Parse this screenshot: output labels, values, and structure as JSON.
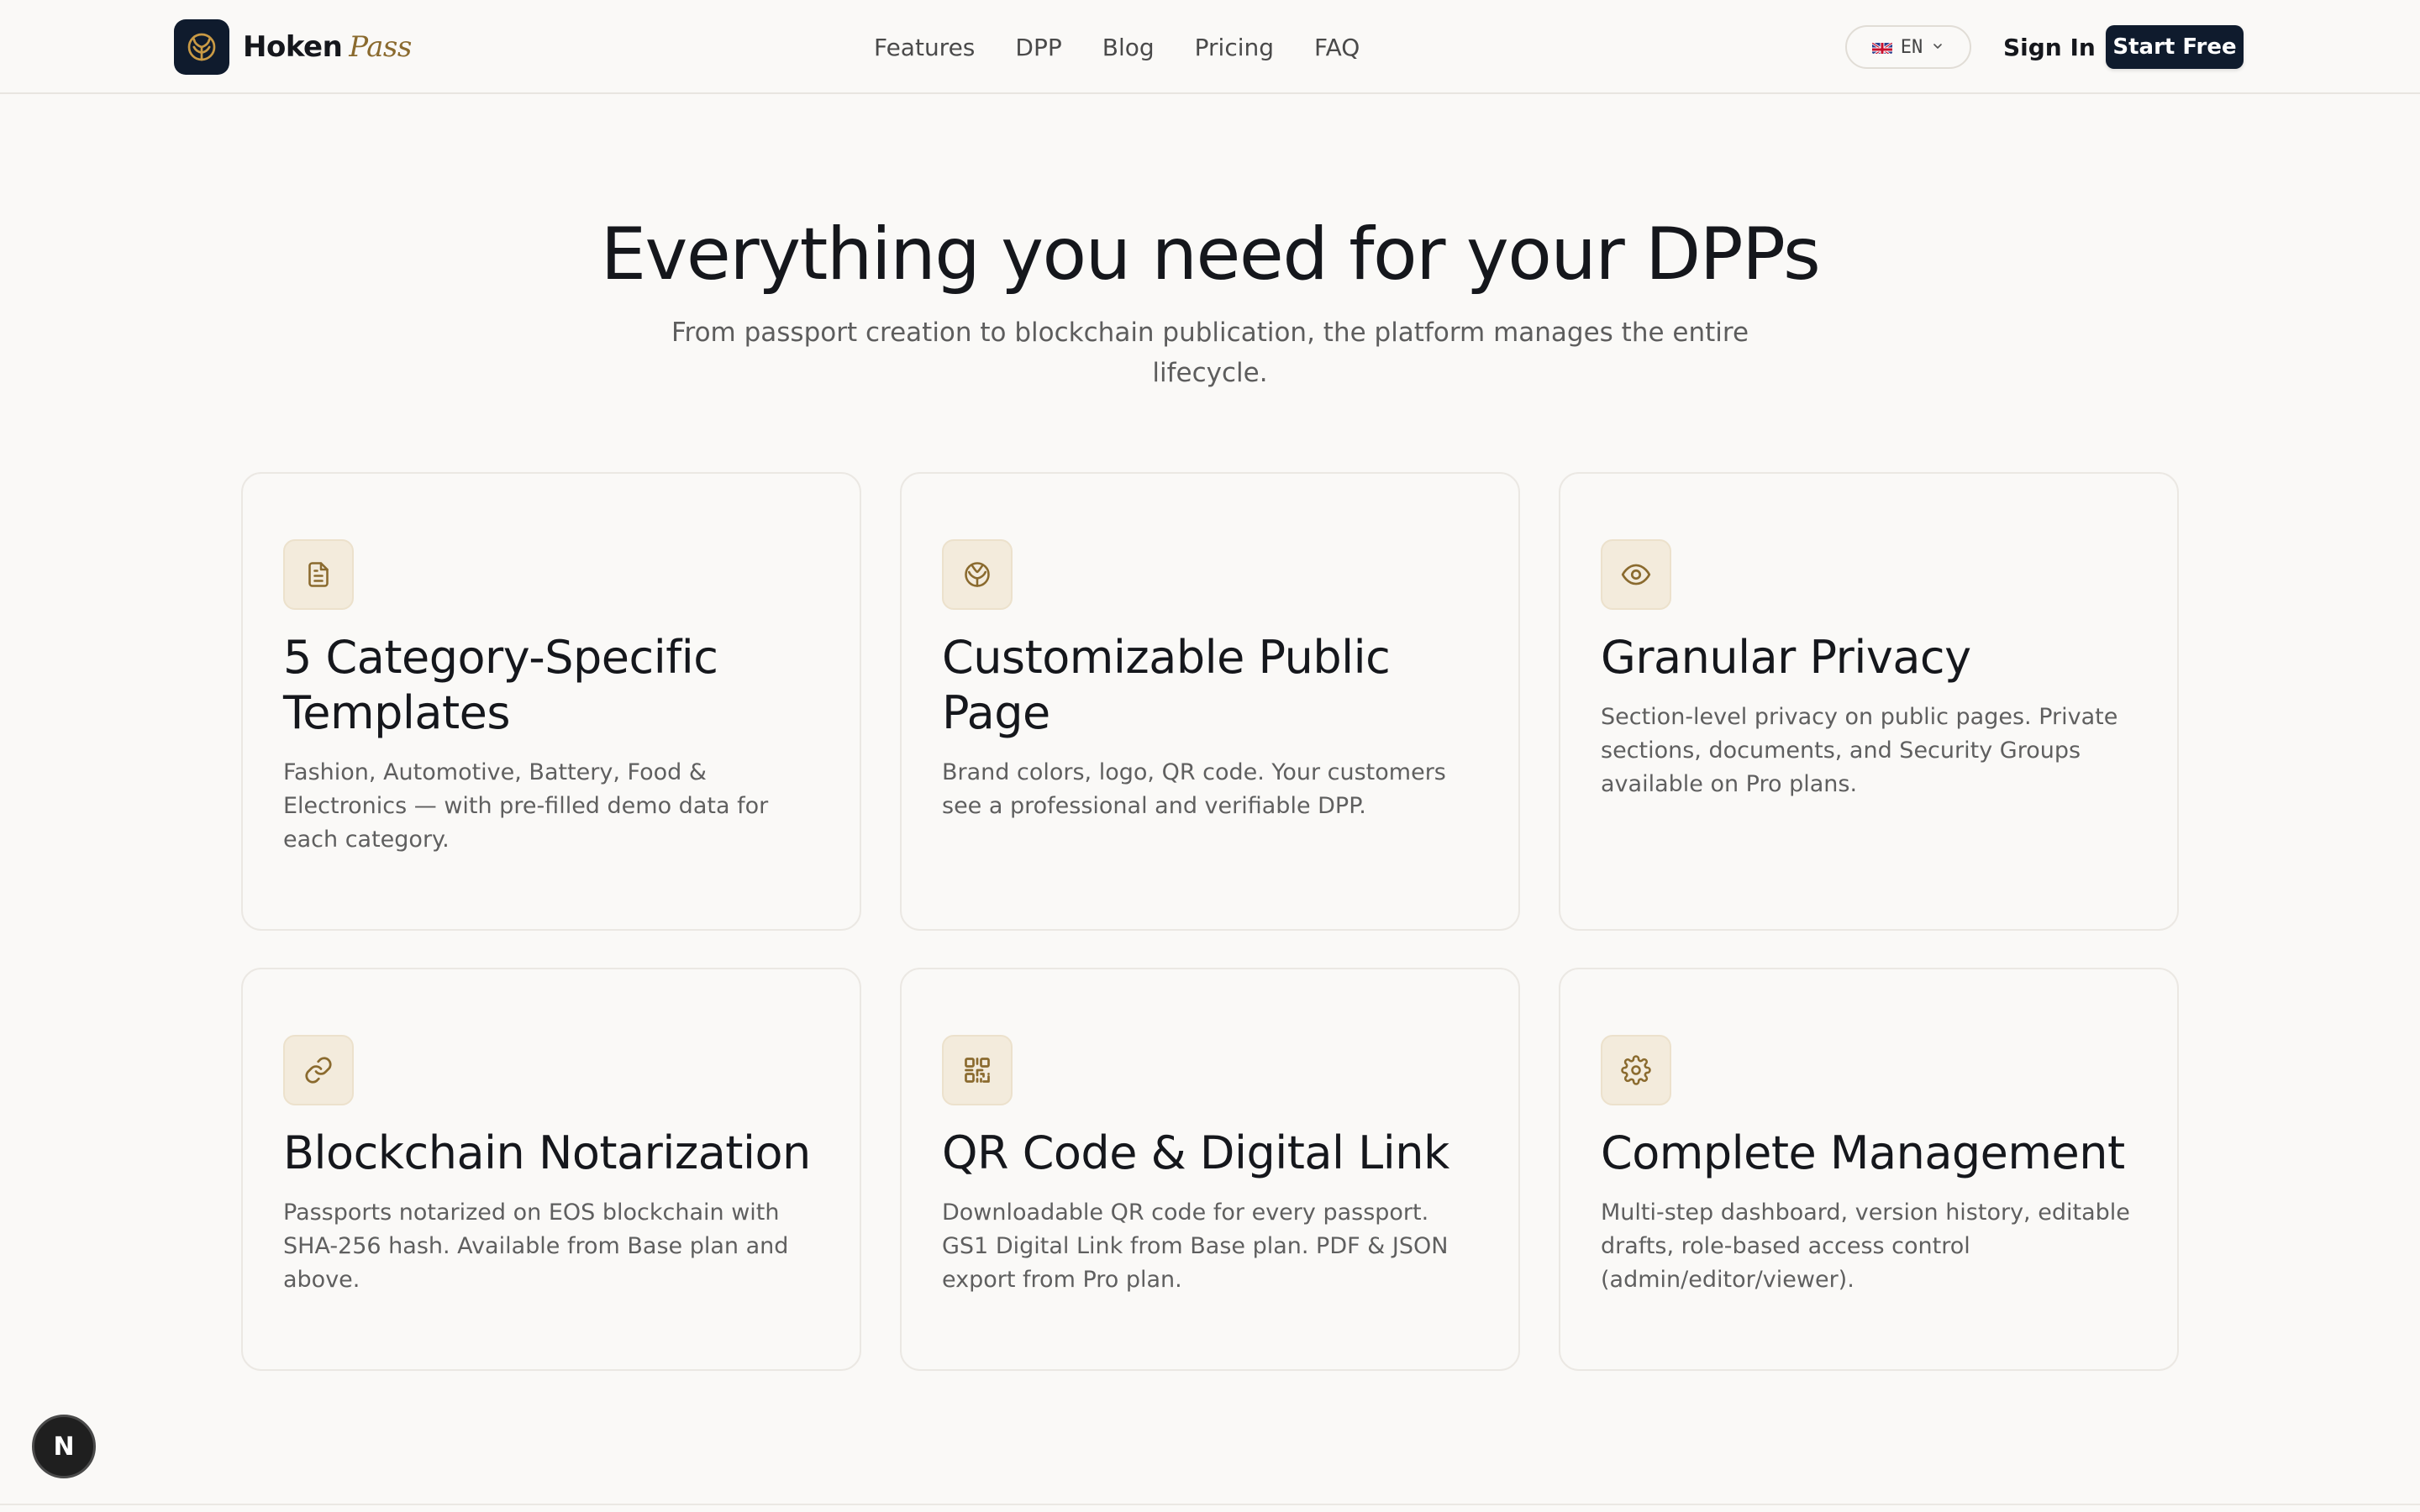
{
  "header": {
    "brand_main": "Hoken",
    "brand_accent": "Pass",
    "nav": [
      "Features",
      "DPP",
      "Blog",
      "Pricing",
      "FAQ"
    ],
    "language": "EN",
    "sign_in": "Sign In",
    "start_free": "Start Free"
  },
  "hero": {
    "title": "Everything you need for your DPPs",
    "subtitle": "From passport creation to blockchain publication, the platform manages the entire lifecycle."
  },
  "features": [
    {
      "icon": "document-icon",
      "title": "5 Category-Specific Templates",
      "description": "Fashion, Automotive, Battery, Food & Electronics — with pre-filled demo data for each category."
    },
    {
      "icon": "globe-icon",
      "title": "Customizable Public Page",
      "description": "Brand colors, logo, QR code. Your customers see a professional and verifiable DPP."
    },
    {
      "icon": "eye-icon",
      "title": "Granular Privacy",
      "description": "Section-level privacy on public pages. Private sections, documents, and Security Groups available on Pro plans."
    },
    {
      "icon": "link-icon",
      "title": "Blockchain Notarization",
      "description": "Passports notarized on EOS blockchain with SHA-256 hash. Available from Base plan and above."
    },
    {
      "icon": "qr-code-icon",
      "title": "QR Code & Digital Link",
      "description": "Downloadable QR code for every passport. GS1 Digital Link from Base plan. PDF & JSON export from Pro plan."
    },
    {
      "icon": "gear-icon",
      "title": "Complete Management",
      "description": "Multi-step dashboard, version history, editable drafts, role-based access control (admin/editor/viewer)."
    }
  ],
  "floating_badge": "N",
  "colors": {
    "brand_dark": "#0f1b2d",
    "accent_gold": "#8a6a2e",
    "icon_tile_bg": "#f3ebdc",
    "page_bg": "#faf9f7"
  }
}
